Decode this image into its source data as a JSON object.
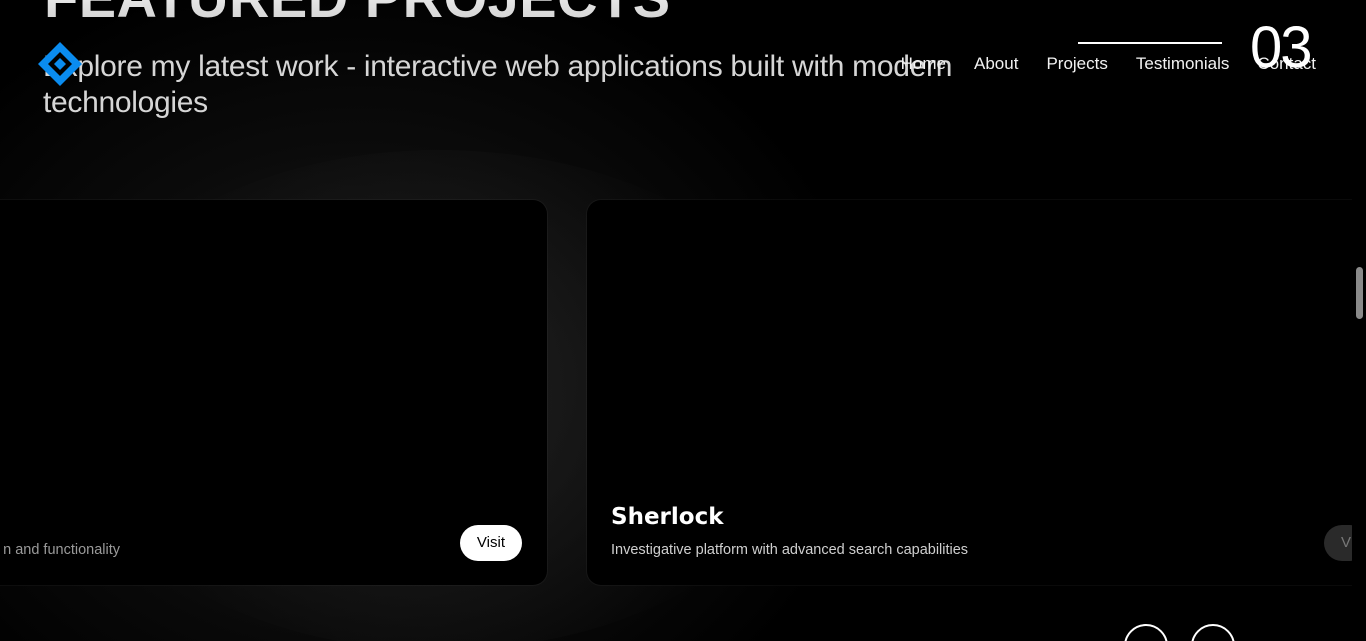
{
  "section": {
    "title": "FEATURED PROJECTS",
    "subtitle": "Explore my latest work - interactive web applications built with modern technologies"
  },
  "nav": {
    "items": [
      {
        "label": "Home"
      },
      {
        "label": "About"
      },
      {
        "label": "Projects"
      },
      {
        "label": "Testimonials"
      },
      {
        "label": "Contact"
      }
    ]
  },
  "counter": "03",
  "projects": [
    {
      "title": "",
      "description": "n and functionality",
      "visit_label": "Visit"
    },
    {
      "title": "Sherlock",
      "description": "Investigative platform with advanced search capabilities",
      "visit_label": "V"
    }
  ],
  "colors": {
    "accent": "#0a8cf0",
    "background": "#000000",
    "text": "#ffffff"
  },
  "icons": {
    "logo": "diamond-logo-icon",
    "prev": "arrow-left-icon",
    "next": "arrow-right-icon"
  }
}
